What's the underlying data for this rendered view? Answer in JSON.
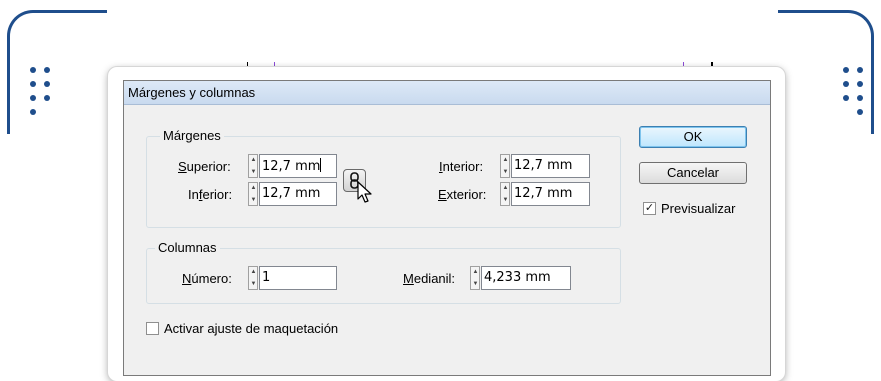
{
  "dialog": {
    "title": "Márgenes y columnas",
    "margins": {
      "group_label": "Márgenes",
      "top": {
        "label_access": "S",
        "label_rest": "uperior:",
        "value": "12,7 mm"
      },
      "bottom": {
        "label_pre": "In",
        "label_access": "f",
        "label_rest": "erior:",
        "value": "12,7 mm"
      },
      "inside": {
        "label_access": "I",
        "label_rest": "nterior:",
        "value": "12,7 mm"
      },
      "outside": {
        "label_access": "E",
        "label_rest": "xterior:",
        "value": "12,7 mm"
      },
      "link_icon": "chain-link-icon"
    },
    "columns": {
      "group_label": "Columnas",
      "number": {
        "label_access": "N",
        "label_rest": "úmero:",
        "value": "1"
      },
      "gutter": {
        "label_access": "M",
        "label_rest": "edianil:",
        "value": "4,233 mm"
      }
    },
    "ok_label": "OK",
    "cancel_label": "Cancelar",
    "preview": {
      "label": "Previsualizar",
      "checked": true
    },
    "layout_adjust": {
      "label": "Activar ajuste de maquetación",
      "checked": false
    }
  },
  "colors": {
    "frame": "#1f4e8c",
    "guide_purple": "#8a4bd6",
    "guide_black": "#000000"
  }
}
